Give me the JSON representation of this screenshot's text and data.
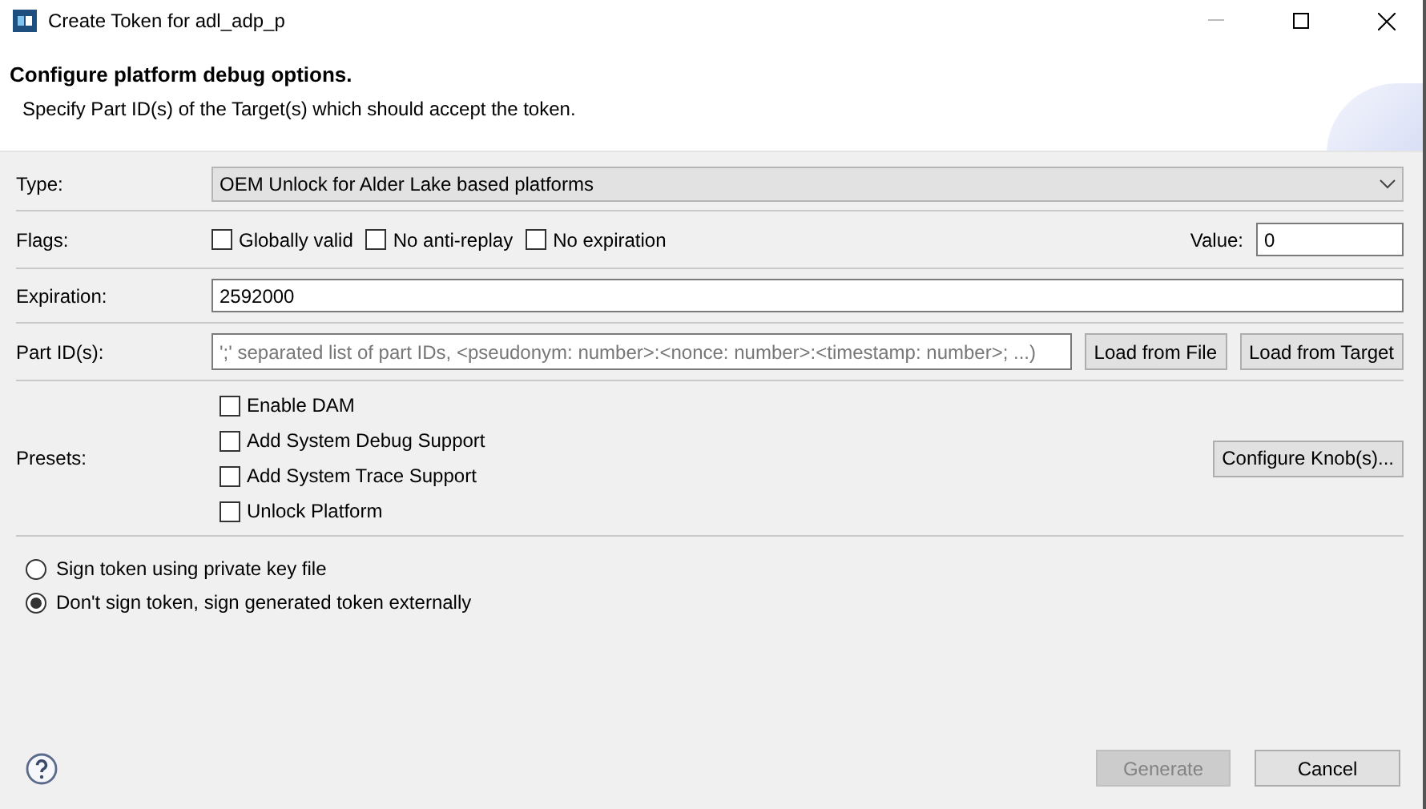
{
  "window": {
    "title": "Create Token for adl_adp_p"
  },
  "header": {
    "title": "Configure platform debug options.",
    "description": "Specify Part ID(s) of the Target(s) which should accept the token."
  },
  "type": {
    "label": "Type:",
    "value": "OEM Unlock for Alder Lake based platforms"
  },
  "flags": {
    "label": "Flags:",
    "items": [
      {
        "label": "Globally valid",
        "checked": false
      },
      {
        "label": "No anti-replay",
        "checked": false
      },
      {
        "label": "No expiration",
        "checked": false
      }
    ],
    "value_label": "Value:",
    "value": "0"
  },
  "expiration": {
    "label": "Expiration:",
    "value": "2592000"
  },
  "part_ids": {
    "label": "Part ID(s):",
    "placeholder": "';' separated list of part IDs, <pseudonym: number>:<nonce: number>:<timestamp: number>; ...)",
    "buttons": [
      "Load from File",
      "Load from Target"
    ]
  },
  "presets": {
    "label": "Presets:",
    "items": [
      {
        "label": "Enable DAM",
        "checked": false
      },
      {
        "label": "Add System Debug Support",
        "checked": false
      },
      {
        "label": "Add System Trace Support",
        "checked": false
      },
      {
        "label": "Unlock Platform",
        "checked": false
      }
    ],
    "button": "Configure Knob(s)..."
  },
  "signing": [
    {
      "label": "Sign token using private key file",
      "selected": false
    },
    {
      "label": "Don't sign token, sign generated token externally",
      "selected": true
    }
  ],
  "footer": {
    "buttons": [
      {
        "label": "Generate",
        "disabled": true
      },
      {
        "label": "Cancel",
        "disabled": false
      }
    ]
  }
}
